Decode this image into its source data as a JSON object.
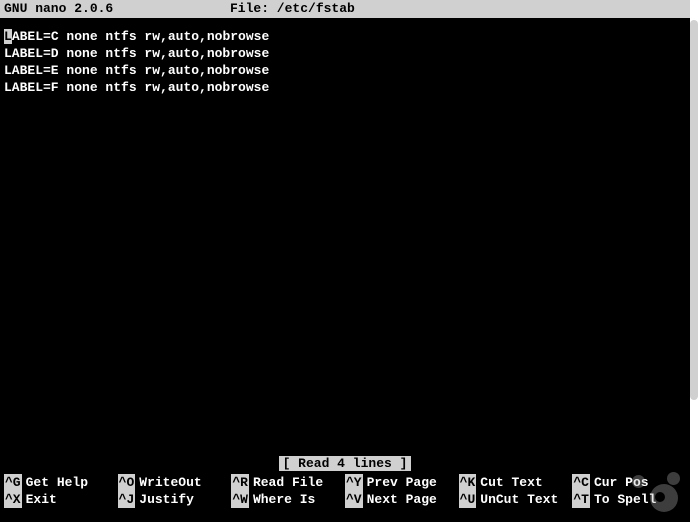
{
  "header": {
    "app": "GNU nano 2.0.6",
    "file_label": "File: /etc/fstab"
  },
  "content": {
    "lines": [
      {
        "cursor": true,
        "first_char": "L",
        "rest": "ABEL=C none ntfs rw,auto,nobrowse"
      },
      {
        "cursor": false,
        "text": "LABEL=D none ntfs rw,auto,nobrowse"
      },
      {
        "cursor": false,
        "text": "LABEL=E none ntfs rw,auto,nobrowse"
      },
      {
        "cursor": false,
        "text": "LABEL=F none ntfs rw,auto,nobrowse"
      }
    ]
  },
  "status": {
    "text": "[ Read 4 lines ]"
  },
  "shortcuts": [
    {
      "key": "^G",
      "label": "Get Help"
    },
    {
      "key": "^O",
      "label": "WriteOut"
    },
    {
      "key": "^R",
      "label": "Read File"
    },
    {
      "key": "^Y",
      "label": "Prev Page"
    },
    {
      "key": "^K",
      "label": "Cut Text"
    },
    {
      "key": "^C",
      "label": "Cur Pos"
    },
    {
      "key": "^X",
      "label": "Exit"
    },
    {
      "key": "^J",
      "label": "Justify"
    },
    {
      "key": "^W",
      "label": "Where Is"
    },
    {
      "key": "^V",
      "label": "Next Page"
    },
    {
      "key": "^U",
      "label": "UnCut Text"
    },
    {
      "key": "^T",
      "label": "To Spell"
    }
  ]
}
